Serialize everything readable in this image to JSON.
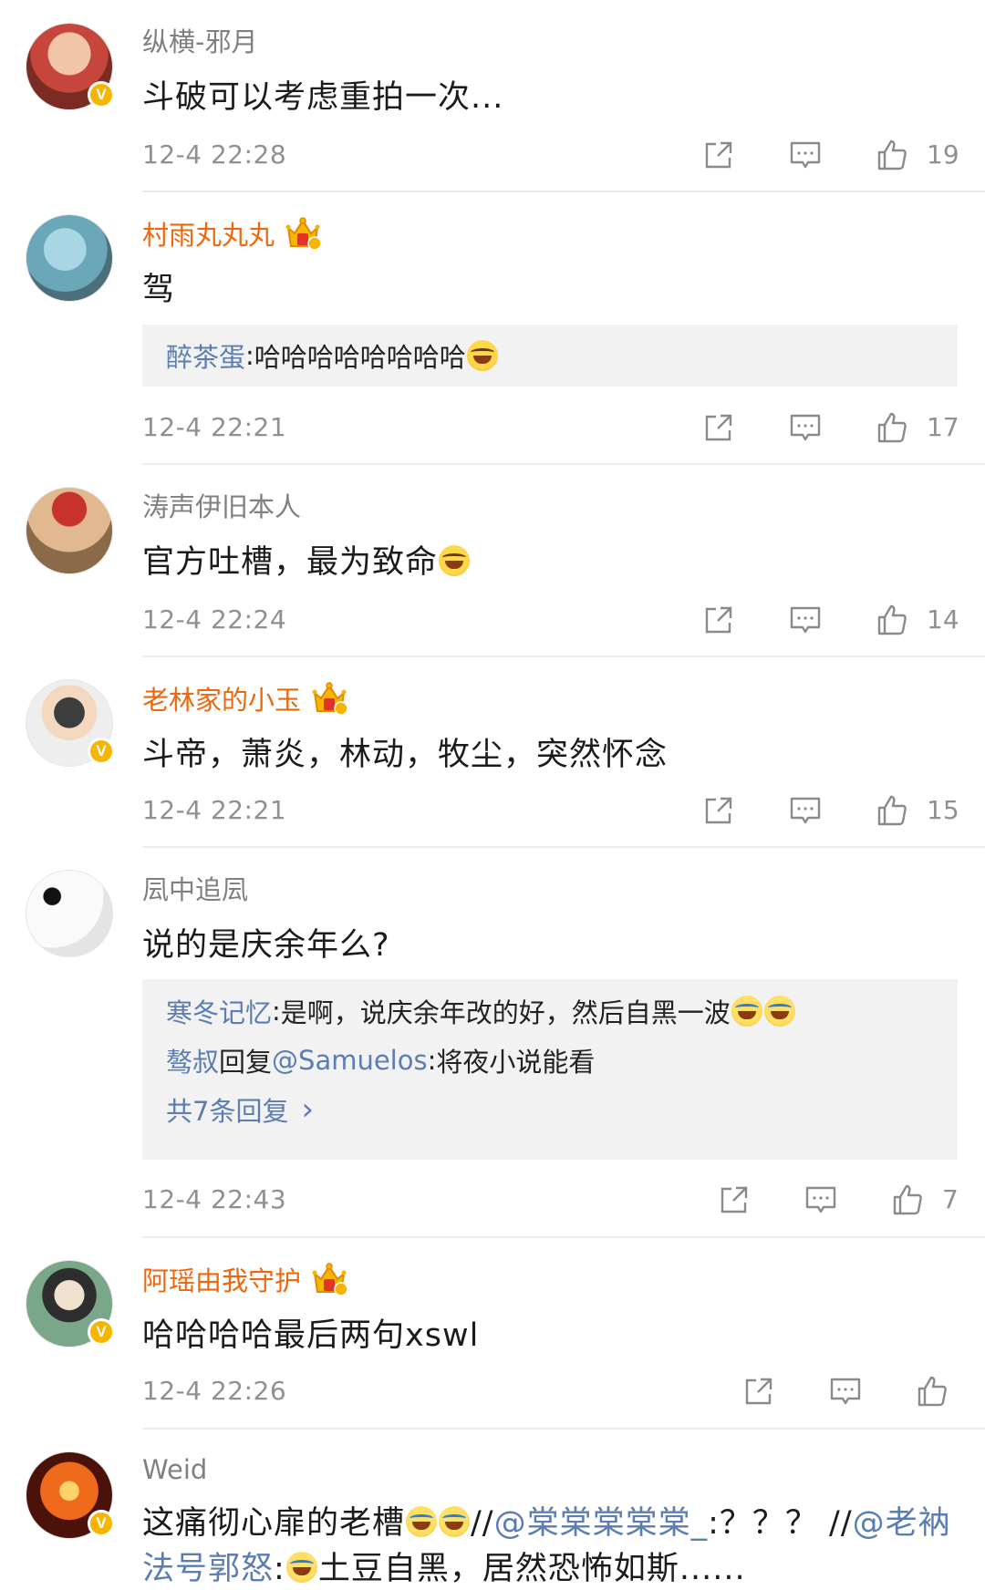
{
  "comments": [
    {
      "username": "纵横-邪月",
      "text": "斗破可以考虑重拍一次...",
      "time": "12-4 22:28",
      "likes": "19",
      "verified": true,
      "vip": false,
      "avatar_color": "#c7463b"
    },
    {
      "username": "村雨丸丸丸",
      "text": "驾",
      "time": "12-4 22:21",
      "likes": "17",
      "verified": false,
      "vip": true,
      "avatar_color": "#6aa7b8",
      "reply": {
        "author": "醉茶蛋",
        "sep": ":",
        "content": " 哈哈哈哈哈哈哈哈"
      }
    },
    {
      "username": "涛声伊旧本人",
      "text": "官方吐槽，最为致命",
      "time": "12-4 22:24",
      "likes": "14",
      "verified": false,
      "vip": false,
      "avatar_color": "#a87a53"
    },
    {
      "username": "老林家的小玉",
      "text": "斗帝，萧炎，林动，牧尘，突然怀念",
      "time": "12-4 22:21",
      "likes": "15",
      "verified": true,
      "vip": true,
      "avatar_color": "#eeeeee"
    },
    {
      "username": "凨中追凨",
      "text": "说的是庆余年么?",
      "time": "12-4 22:43",
      "likes": "7",
      "verified": false,
      "vip": false,
      "avatar_color": "#f6f6f6",
      "replies": [
        {
          "author": "寒冬记忆",
          "sep": ":",
          "content": " 是啊，说庆余年改的好，然后自黑一波"
        },
        {
          "author": "骜叔",
          "mid": "回复",
          "mention": "@Samuelos",
          "sep": ":",
          "content": "将夜小说能看"
        }
      ],
      "more_replies": "共7条回复"
    },
    {
      "username": "阿瑶由我守护",
      "text": "哈哈哈哈最后两句xswl",
      "time": "12-4 22:26",
      "likes": "",
      "verified": true,
      "vip": true,
      "avatar_color": "#7aa68a"
    },
    {
      "username": "Weid",
      "text_part1": "这痛彻心扉的老槽",
      "text_part2": "//",
      "mention1": "@棠棠棠棠棠_",
      "text_part3": ":？？？ //",
      "mention2": "@老衲法号郭怒",
      "text_part4": ":",
      "text_part5": "土豆自黑，居然恐怖如斯......",
      "verified": true,
      "vip": false,
      "avatar_color": "#c2410c"
    }
  ],
  "icons": {
    "share": "share-icon",
    "comment": "comment-icon",
    "like": "thumbs-up-icon",
    "crown": "vip-crown-icon",
    "verified": "verified-v-icon",
    "chevron": "chevron-right-icon"
  },
  "colors": {
    "vip_name": "#f0660b",
    "link": "#5b7db1",
    "meta": "#909090",
    "verified": "#f7b500",
    "reply_bg": "#f2f2f2"
  },
  "verified_mark": "V",
  "chevron_glyph": "›"
}
